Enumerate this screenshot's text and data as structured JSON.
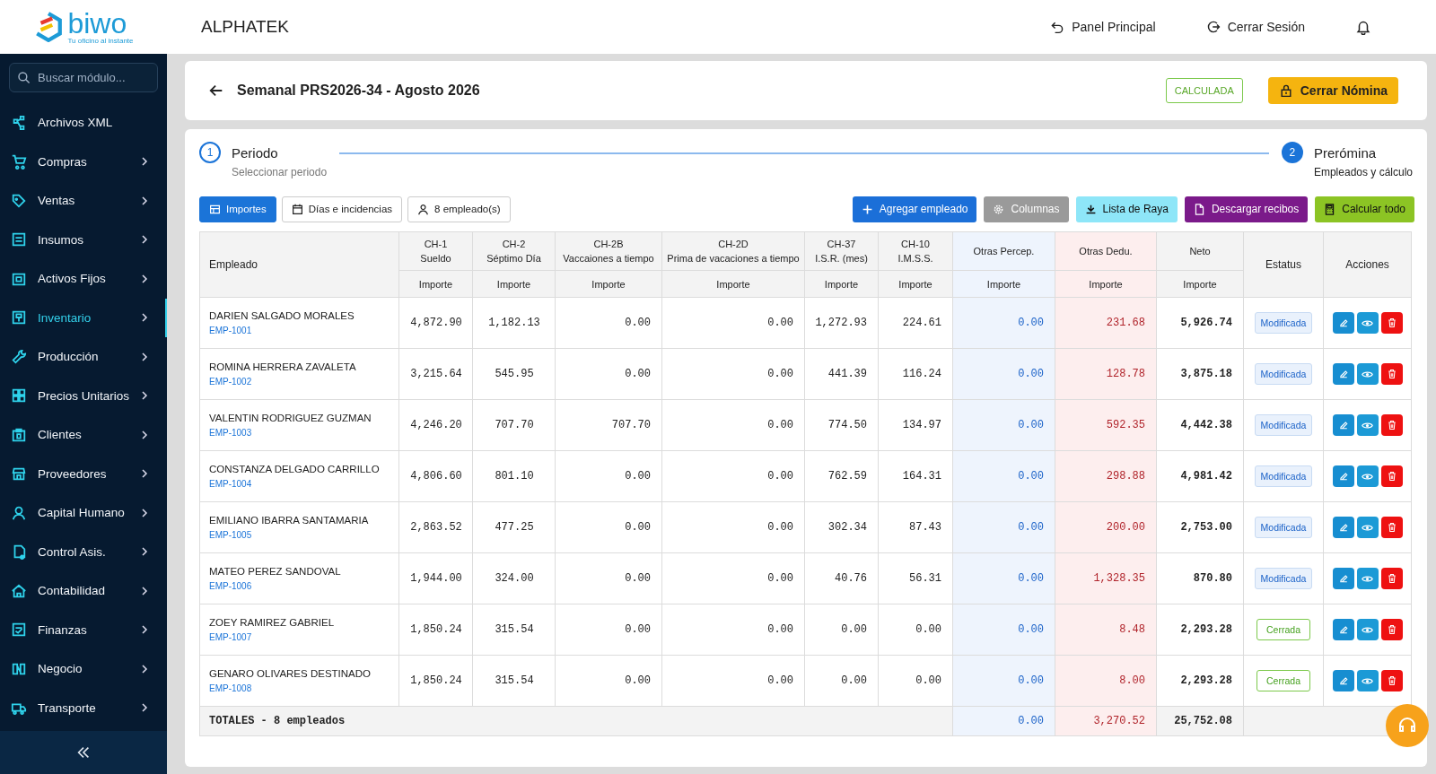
{
  "brand": {
    "name": "biwo",
    "tagline": "Tu oficino al instante"
  },
  "company": "ALPHATEK",
  "header_links": [
    {
      "label": "Panel Principal"
    },
    {
      "label": "Cerrar Sesión"
    }
  ],
  "sidebar": {
    "search": {
      "placeholder": "Buscar módulo..."
    },
    "items": [
      {
        "label": "Archivos XML",
        "expandable": false,
        "selected": false
      },
      {
        "label": "Compras",
        "expandable": true,
        "selected": false
      },
      {
        "label": "Ventas",
        "expandable": true,
        "selected": false
      },
      {
        "label": "Insumos",
        "expandable": true,
        "selected": false
      },
      {
        "label": "Activos Fijos",
        "expandable": true,
        "selected": false
      },
      {
        "label": "Inventario",
        "expandable": true,
        "selected": true
      },
      {
        "label": "Producción",
        "expandable": true,
        "selected": false
      },
      {
        "label": "Precios Unitarios",
        "expandable": true,
        "selected": false
      },
      {
        "label": "Clientes",
        "expandable": true,
        "selected": false
      },
      {
        "label": "Proveedores",
        "expandable": true,
        "selected": false
      },
      {
        "label": "Capital Humano",
        "expandable": true,
        "selected": false
      },
      {
        "label": "Control Asis.",
        "expandable": true,
        "selected": false
      },
      {
        "label": "Contabilidad",
        "expandable": true,
        "selected": false
      },
      {
        "label": "Finanzas",
        "expandable": true,
        "selected": false
      },
      {
        "label": "Negocio",
        "expandable": true,
        "selected": false
      },
      {
        "label": "Transporte",
        "expandable": true,
        "selected": false
      }
    ]
  },
  "page": {
    "title": "Semanal PRS2026-34 - Agosto 2026",
    "status": "CALCULADA",
    "close_button": "Cerrar Nómina"
  },
  "stepper": [
    {
      "number": "1",
      "title": "Periodo",
      "subtitle": "Seleccionar periodo",
      "active": false
    },
    {
      "number": "2",
      "title": "Prerómina",
      "subtitle": "Empleados y cálculo",
      "active": true
    }
  ],
  "tabs": [
    {
      "label": "Importes",
      "selected": true
    },
    {
      "label": "Días e incidencias",
      "selected": false
    },
    {
      "label": "8 empleado(s)",
      "selected": false
    }
  ],
  "actions": [
    {
      "label": "Agregar empleado",
      "kind": "add"
    },
    {
      "label": "Columnas",
      "kind": "columns"
    },
    {
      "label": "Lista de Raya",
      "kind": "download"
    },
    {
      "label": "Descargar recibos",
      "kind": "receipts"
    },
    {
      "label": "Calcular todo",
      "kind": "calculate"
    }
  ],
  "table": {
    "employee_header": "Empleado",
    "concepts": [
      {
        "code": "CH-1",
        "name": "Sueldo",
        "subheader": "Importe"
      },
      {
        "code": "CH-2",
        "name": "Séptimo Día",
        "subheader": "Importe"
      },
      {
        "code": "CH-2B",
        "name": "Vaccaiones a tiempo",
        "subheader": "Importe"
      },
      {
        "code": "CH-2D",
        "name": "Prima de vacaciones a tiempo",
        "subheader": "Importe"
      },
      {
        "code": "CH-37",
        "name": "I.S.R. (mes)",
        "subheader": "Importe"
      },
      {
        "code": "CH-10",
        "name": "I.M.S.S.",
        "subheader": "Importe"
      }
    ],
    "percep_header": {
      "label": "Otras Percep.",
      "subheader": "Importe"
    },
    "dedu_header": {
      "label": "Otras Dedu.",
      "subheader": "Importe"
    },
    "neto_header": {
      "label": "Neto",
      "subheader": "Importe"
    },
    "status_header": "Estatus",
    "actions_header": "Acciones",
    "rows": [
      {
        "name": "DARIEN SALGADO MORALES",
        "id": "EMP-1001",
        "values": [
          "4,872.90",
          "1,182.13",
          "0.00",
          "0.00",
          "1,272.93",
          "224.61"
        ],
        "otras_percep": "0.00",
        "otras_dedu": "231.68",
        "neto": "5,926.74",
        "status": {
          "label": "Modificada",
          "kind": "modified"
        }
      },
      {
        "name": "ROMINA HERRERA ZAVALETA",
        "id": "EMP-1002",
        "values": [
          "3,215.64",
          "545.95",
          "0.00",
          "0.00",
          "441.39",
          "116.24"
        ],
        "otras_percep": "0.00",
        "otras_dedu": "128.78",
        "neto": "3,875.18",
        "status": {
          "label": "Modificada",
          "kind": "modified"
        }
      },
      {
        "name": "VALENTIN RODRIGUEZ GUZMAN",
        "id": "EMP-1003",
        "values": [
          "4,246.20",
          "707.70",
          "707.70",
          "0.00",
          "774.50",
          "134.97"
        ],
        "otras_percep": "0.00",
        "otras_dedu": "592.35",
        "neto": "4,442.38",
        "status": {
          "label": "Modificada",
          "kind": "modified"
        }
      },
      {
        "name": "CONSTANZA DELGADO CARRILLO",
        "id": "EMP-1004",
        "values": [
          "4,806.60",
          "801.10",
          "0.00",
          "0.00",
          "762.59",
          "164.31"
        ],
        "otras_percep": "0.00",
        "otras_dedu": "298.88",
        "neto": "4,981.42",
        "status": {
          "label": "Modificada",
          "kind": "modified"
        }
      },
      {
        "name": "EMILIANO IBARRA SANTAMARIA",
        "id": "EMP-1005",
        "values": [
          "2,863.52",
          "477.25",
          "0.00",
          "0.00",
          "302.34",
          "87.43"
        ],
        "otras_percep": "0.00",
        "otras_dedu": "200.00",
        "neto": "2,753.00",
        "status": {
          "label": "Modificada",
          "kind": "modified"
        }
      },
      {
        "name": "MATEO PEREZ SANDOVAL",
        "id": "EMP-1006",
        "values": [
          "1,944.00",
          "324.00",
          "0.00",
          "0.00",
          "40.76",
          "56.31"
        ],
        "otras_percep": "0.00",
        "otras_dedu": "1,328.35",
        "neto": "870.80",
        "status": {
          "label": "Modificada",
          "kind": "modified"
        }
      },
      {
        "name": "ZOEY RAMIREZ GABRIEL",
        "id": "EMP-1007",
        "values": [
          "1,850.24",
          "315.54",
          "0.00",
          "0.00",
          "0.00",
          "0.00"
        ],
        "otras_percep": "0.00",
        "otras_dedu": "8.48",
        "neto": "2,293.28",
        "status": {
          "label": "Cerrada",
          "kind": "closed"
        }
      },
      {
        "name": "GENARO OLIVARES DESTINADO",
        "id": "EMP-1008",
        "values": [
          "1,850.24",
          "315.54",
          "0.00",
          "0.00",
          "0.00",
          "0.00"
        ],
        "otras_percep": "0.00",
        "otras_dedu": "8.00",
        "neto": "2,293.28",
        "status": {
          "label": "Cerrada",
          "kind": "closed"
        }
      }
    ],
    "totals": {
      "label": "TOTALES - 8 empleados",
      "otras_percep": "0.00",
      "otras_dedu": "3,270.52",
      "neto": "25,752.08"
    }
  }
}
